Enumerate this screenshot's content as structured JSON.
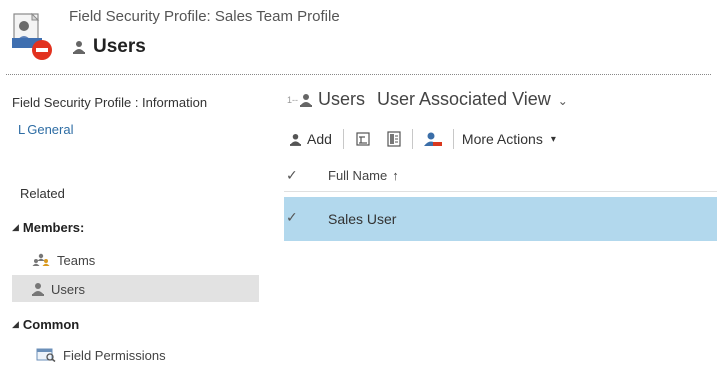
{
  "header": {
    "title": "Field Security Profile: Sales Team Profile",
    "entity_label": "Users",
    "icon": "field-security-profile-icon"
  },
  "nav": {
    "section_title": "Field Security Profile : Information",
    "general_prefix": "L",
    "general_label": "General",
    "related_label": "Related",
    "groups": [
      {
        "label": "Members:",
        "items": [
          {
            "label": "Teams",
            "icon": "teams-icon"
          },
          {
            "label": "Users",
            "icon": "user-icon",
            "selected": true
          }
        ]
      },
      {
        "label": "Common",
        "items": [
          {
            "label": "Field Permissions",
            "icon": "field-permissions-icon"
          }
        ]
      }
    ]
  },
  "view": {
    "prefix": "1--",
    "entity": "Users",
    "name": "User Associated View",
    "chevron": "⌄"
  },
  "toolbar": {
    "add_label": "Add",
    "more_actions_label": "More Actions",
    "more_actions_caret": "▾"
  },
  "grid": {
    "check_glyph": "✓",
    "columns": [
      {
        "label": "Full Name",
        "sort": "↑"
      }
    ],
    "rows": [
      {
        "full_name": "Sales User",
        "selected": true
      }
    ]
  },
  "colors": {
    "selected_row": "#b2d8ed",
    "selected_nav": "#e2e2e2",
    "link": "#2e6da4"
  }
}
